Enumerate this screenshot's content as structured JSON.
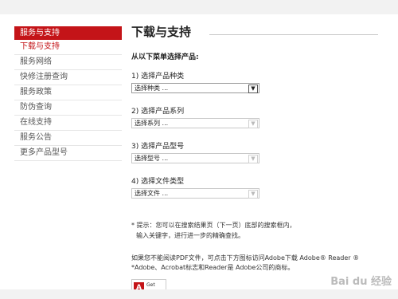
{
  "sidebar": {
    "header": "服务与支持",
    "items": [
      {
        "label": "下载与支持",
        "active": true
      },
      {
        "label": "服务网络"
      },
      {
        "label": "快修注册查询"
      },
      {
        "label": "服务政策"
      },
      {
        "label": "防伪查询"
      },
      {
        "label": "在线支持"
      },
      {
        "label": "服务公告"
      },
      {
        "label": "更多产品型号"
      }
    ]
  },
  "main": {
    "title": "下载与支持",
    "intro": "从以下菜单选择产品:",
    "steps": [
      {
        "label": "1) 选择产品种类",
        "selected": "选择种类 ...",
        "enabled": true
      },
      {
        "label": "2) 选择产品系列",
        "selected": "选择系列 ...",
        "enabled": false
      },
      {
        "label": "3) 选择产品型号",
        "selected": "选择型号 ...",
        "enabled": false
      },
      {
        "label": "4) 选择文件类型",
        "selected": "选择文件 ...",
        "enabled": false
      }
    ],
    "tip_line1": "* 提示：您可以在搜索结果页（下一页）底部的搜索框内，",
    "tip_line2": "输入关键字，进行进一步的精确查找。",
    "pdf_line1": "如果您不能阅读PDF文件，可点击下方图标访问Adobe下载 Adobe® Reader ®",
    "pdf_line2": "*Adobe、Acrobat标志和Reader是 Adobe公司的商标。",
    "get_reader": "Get"
  },
  "watermark": "Bai du 经验",
  "colors": {
    "accent": "#c41418"
  }
}
